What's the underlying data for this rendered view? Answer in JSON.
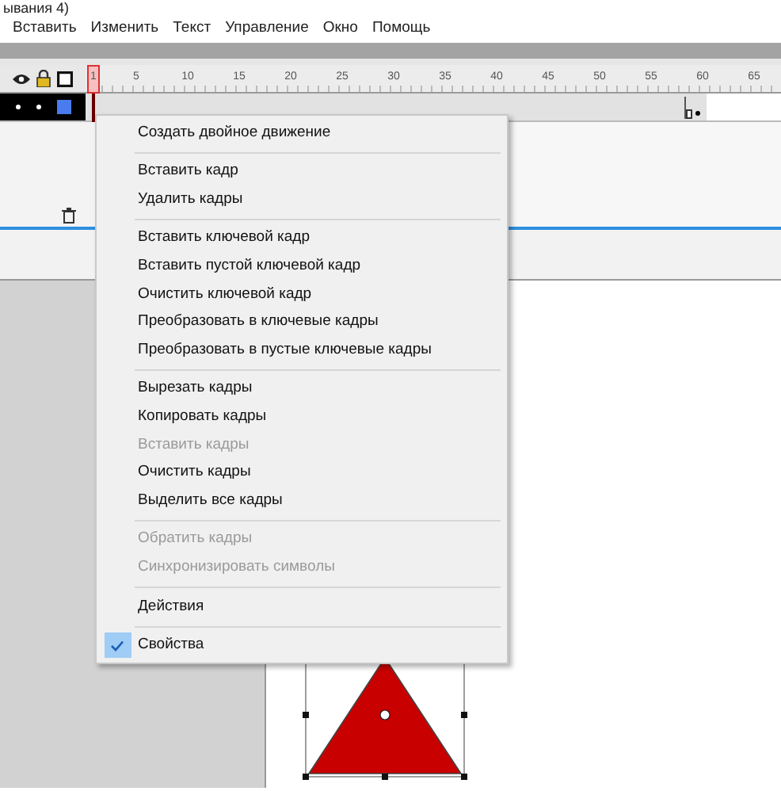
{
  "window": {
    "title": "ывания 4)"
  },
  "menu_bar": [
    {
      "label": "Вставить"
    },
    {
      "label": "Изменить"
    },
    {
      "label": "Текст"
    },
    {
      "label": "Управление"
    },
    {
      "label": "Окно"
    },
    {
      "label": "Помощь"
    }
  ],
  "timeline": {
    "ruler_labels": [
      "1",
      "5",
      "10",
      "15",
      "20",
      "25",
      "30",
      "35",
      "40",
      "45",
      "50",
      "55",
      "60",
      "65"
    ]
  },
  "context_menu": [
    {
      "kind": "item",
      "label": "Создать двойное движение",
      "disabled": false,
      "checked": false
    },
    {
      "kind": "separator"
    },
    {
      "kind": "item",
      "label": "Вставить кадр",
      "disabled": false,
      "checked": false
    },
    {
      "kind": "item",
      "label": "Удалить кадры",
      "disabled": false,
      "checked": false
    },
    {
      "kind": "separator"
    },
    {
      "kind": "item",
      "label": "Вставить ключевой кадр",
      "disabled": false,
      "checked": false
    },
    {
      "kind": "item",
      "label": "Вставить пустой ключевой кадр",
      "disabled": false,
      "checked": false
    },
    {
      "kind": "item",
      "label": "Очистить ключевой кадр",
      "disabled": false,
      "checked": false
    },
    {
      "kind": "item",
      "label": "Преобразовать в ключевые кадры",
      "disabled": false,
      "checked": false
    },
    {
      "kind": "item",
      "label": "Преобразовать в пустые ключевые кадры",
      "disabled": false,
      "checked": false
    },
    {
      "kind": "separator"
    },
    {
      "kind": "item",
      "label": "Вырезать кадры",
      "disabled": false,
      "checked": false
    },
    {
      "kind": "item",
      "label": "Копировать кадры",
      "disabled": false,
      "checked": false
    },
    {
      "kind": "item",
      "label": "Вставить кадры",
      "disabled": true,
      "checked": false
    },
    {
      "kind": "item",
      "label": "Очистить кадры",
      "disabled": false,
      "checked": false
    },
    {
      "kind": "item",
      "label": "Выделить все кадры",
      "disabled": false,
      "checked": false
    },
    {
      "kind": "separator"
    },
    {
      "kind": "item",
      "label": "Обратить кадры",
      "disabled": true,
      "checked": false
    },
    {
      "kind": "item",
      "label": "Синхронизировать символы",
      "disabled": true,
      "checked": false
    },
    {
      "kind": "separator"
    },
    {
      "kind": "item",
      "label": "Действия",
      "disabled": false,
      "checked": false
    },
    {
      "kind": "separator"
    },
    {
      "kind": "item",
      "label": "Свойства",
      "disabled": false,
      "checked": true
    }
  ]
}
